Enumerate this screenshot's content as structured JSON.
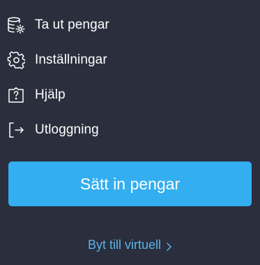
{
  "menu": {
    "items": [
      {
        "label": "Ta ut pengar",
        "icon": "database-gear-icon"
      },
      {
        "label": "Inställningar",
        "icon": "gear-icon"
      },
      {
        "label": "Hjälp",
        "icon": "help-icon"
      },
      {
        "label": "Utloggning",
        "icon": "logout-icon"
      }
    ]
  },
  "deposit": {
    "label": "Sätt in pengar"
  },
  "virtual": {
    "label": "Byt till virtuell",
    "icon": "chevron-right-icon"
  },
  "colors": {
    "background": "#2a2e3d",
    "button": "#33aef0",
    "link": "#59b4e8",
    "text": "#ffffff"
  }
}
